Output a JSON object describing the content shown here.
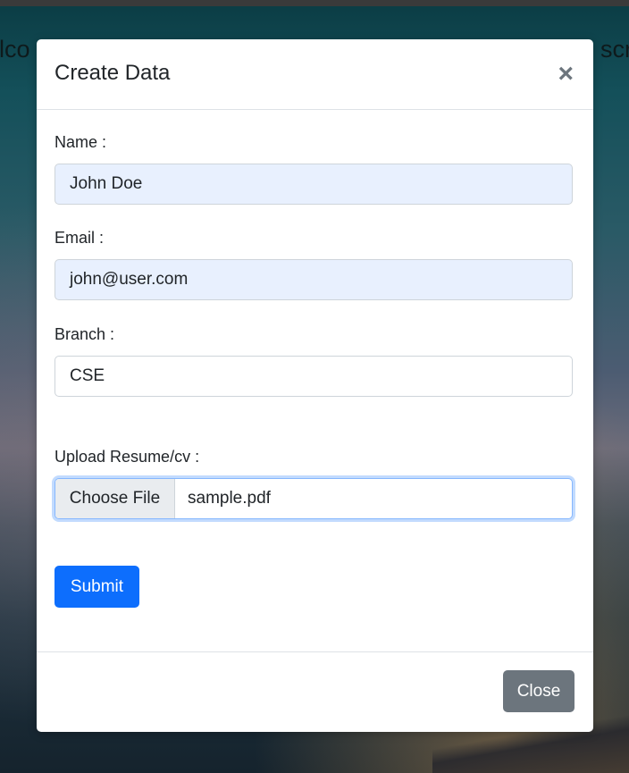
{
  "background": {
    "left_text": "lco",
    "right_text": "scr"
  },
  "modal": {
    "title": "Create Data",
    "close_icon": "close-icon",
    "fields": {
      "name": {
        "label": "Name :",
        "value": "John Doe"
      },
      "email": {
        "label": "Email :",
        "value": "john@user.com"
      },
      "branch": {
        "label": "Branch :",
        "value": "CSE"
      },
      "resume": {
        "label": "Upload Resume/cv :",
        "button_label": "Choose File",
        "file_name": "sample.pdf"
      }
    },
    "submit_label": "Submit",
    "close_label": "Close"
  },
  "colors": {
    "primary": "#0d6efd",
    "secondary": "#6c757d",
    "autofill": "#e8f0fe"
  }
}
